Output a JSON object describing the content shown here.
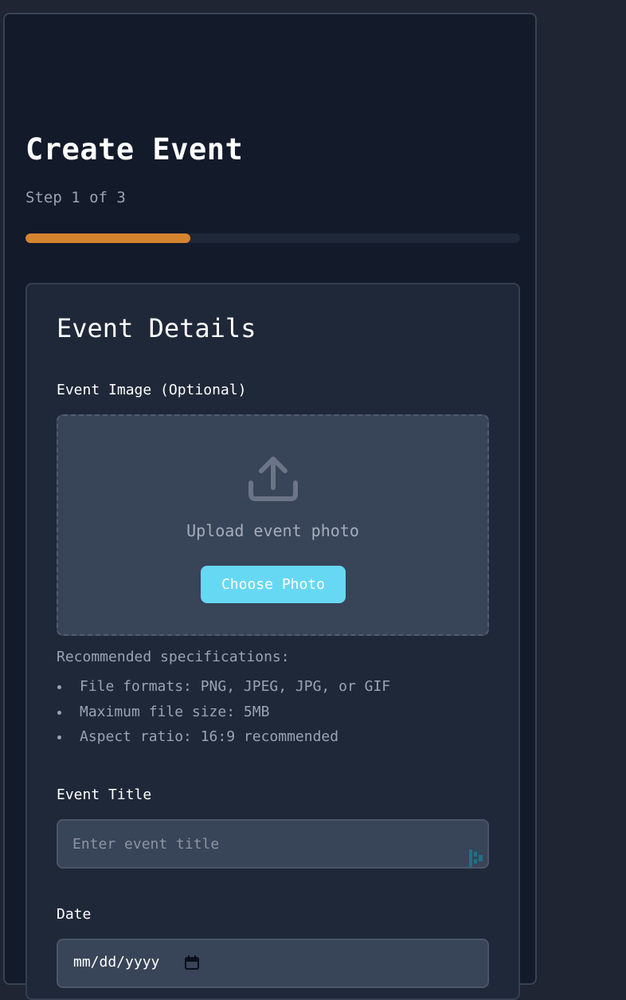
{
  "header": {
    "title": "Create Event",
    "step": "Step 1 of 3",
    "progress": 0.333
  },
  "card": {
    "title": "Event Details",
    "image_field": {
      "label": "Event Image (Optional)",
      "upload_icon": "upload-icon",
      "upload_text": "Upload event photo",
      "button_label": "Choose Photo"
    },
    "specs": {
      "title": "Recommended specifications:",
      "items": [
        "File formats: PNG, JPEG, JPG, or GIF",
        "Maximum file size: 5MB",
        "Aspect ratio: 16:9 recommended"
      ]
    },
    "title_field": {
      "label": "Event Title",
      "placeholder": "Enter event title",
      "value": ""
    },
    "date_field": {
      "label": "Date",
      "value": "mm/dd/yyyy",
      "icon": "calendar-icon"
    }
  },
  "colors": {
    "accent": "#d6832f",
    "button": "#67d8f4",
    "background": "#131a2a",
    "card": "#1f2838"
  }
}
